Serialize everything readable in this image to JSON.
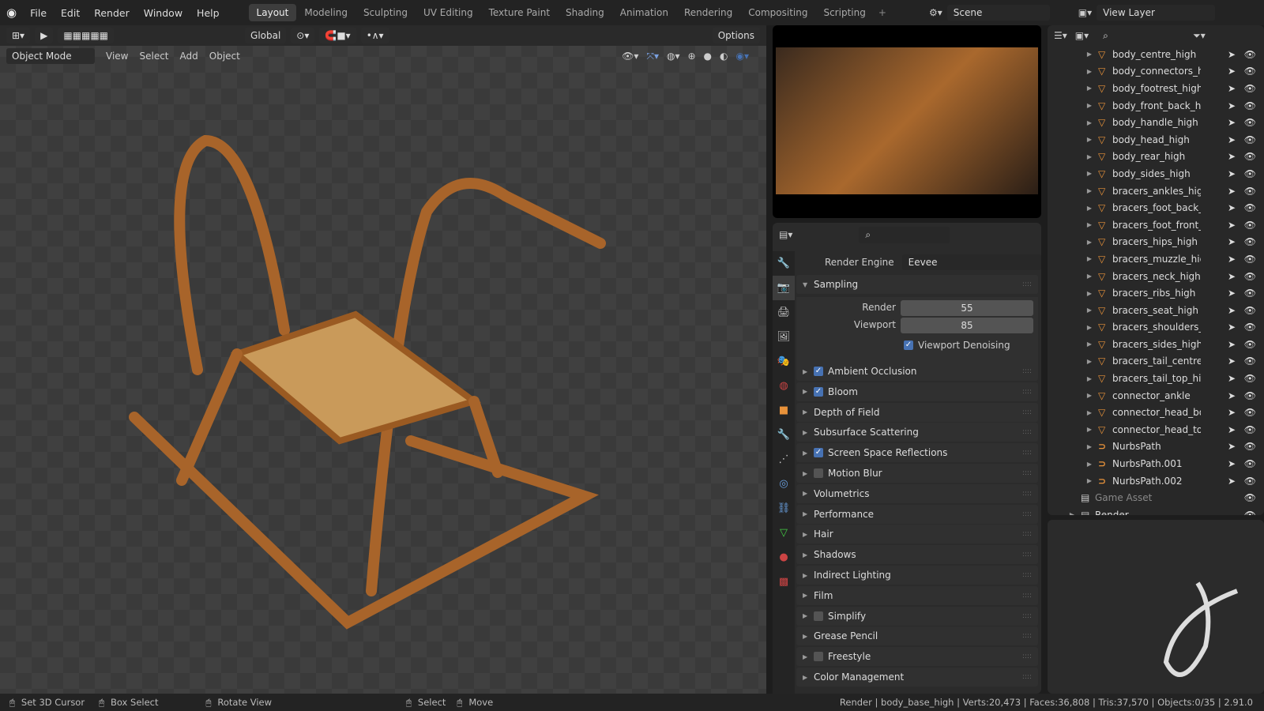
{
  "menu": [
    "File",
    "Edit",
    "Render",
    "Window",
    "Help"
  ],
  "workspaces": [
    "Layout",
    "Modeling",
    "Sculpting",
    "UV Editing",
    "Texture Paint",
    "Shading",
    "Animation",
    "Rendering",
    "Compositing",
    "Scripting"
  ],
  "active_workspace": "Layout",
  "scene": "Scene",
  "view_layer": "View Layer",
  "viewport": {
    "orientation": "Global",
    "options": "Options",
    "mode": "Object Mode",
    "menus": [
      "View",
      "Select",
      "Add",
      "Object"
    ]
  },
  "properties": {
    "render_engine_label": "Render Engine",
    "render_engine": "Eevee",
    "sampling": "Sampling",
    "render_label": "Render",
    "render_value": "55",
    "viewport_label": "Viewport",
    "viewport_value": "85",
    "viewport_denoising": "Viewport Denoising",
    "panels": [
      {
        "label": "Ambient Occlusion",
        "checkbox": true,
        "checked": true
      },
      {
        "label": "Bloom",
        "checkbox": true,
        "checked": true
      },
      {
        "label": "Depth of Field"
      },
      {
        "label": "Subsurface Scattering"
      },
      {
        "label": "Screen Space Reflections",
        "checkbox": true,
        "checked": true
      },
      {
        "label": "Motion Blur",
        "checkbox": true,
        "checked": false
      },
      {
        "label": "Volumetrics"
      },
      {
        "label": "Performance"
      },
      {
        "label": "Hair"
      },
      {
        "label": "Shadows"
      },
      {
        "label": "Indirect Lighting"
      },
      {
        "label": "Film"
      },
      {
        "label": "Simplify",
        "checkbox": true,
        "checked": false
      },
      {
        "label": "Grease Pencil"
      },
      {
        "label": "Freestyle",
        "checkbox": true,
        "checked": false
      },
      {
        "label": "Color Management"
      }
    ]
  },
  "outliner": {
    "items": [
      "body_centre_high",
      "body_connectors_high",
      "body_footrest_high",
      "body_front_back_high",
      "body_handle_high",
      "body_head_high",
      "body_rear_high",
      "body_sides_high",
      "bracers_ankles_high",
      "bracers_foot_back_high",
      "bracers_foot_front_high",
      "bracers_hips_high",
      "bracers_muzzle_high",
      "bracers_neck_high",
      "bracers_ribs_high",
      "bracers_seat_high",
      "bracers_shoulders_high",
      "bracers_sides_high",
      "bracers_tail_centre_high",
      "bracers_tail_top_high",
      "connector_ankle",
      "connector_head_bottom",
      "connector_head_top",
      "NurbsPath",
      "NurbsPath.001",
      "NurbsPath.002"
    ],
    "collections": [
      "Game Asset",
      "Render"
    ]
  },
  "status": {
    "set_cursor": "Set 3D Cursor",
    "box_select": "Box Select",
    "rotate": "Rotate View",
    "select": "Select",
    "move": "Move",
    "info": "Render | body_base_high | Verts:20,473 | Faces:36,808 | Tris:37,570 | Objects:0/35 | 2.91.0"
  }
}
